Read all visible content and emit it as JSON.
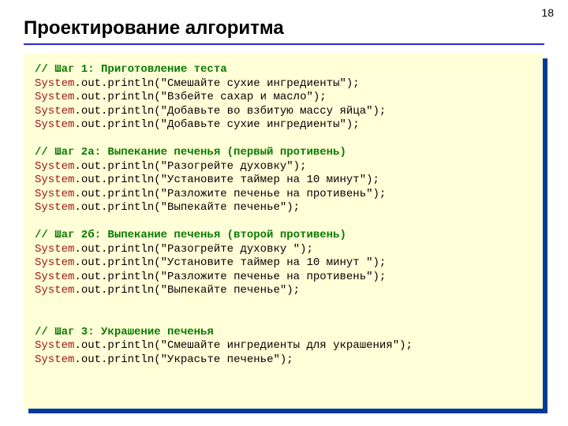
{
  "page_number": "18",
  "title": "Проектирование алгоритма",
  "code": {
    "sys": "System",
    "out_print": ".out.println",
    "c1": "// Шаг 1: Приготовление теста",
    "s1": "(\"Смешайте сухие ингредиенты\");",
    "s2": "(\"Взбейте сахар и масло\");",
    "s3": "(\"Добавьте во взбитую массу яйца\");",
    "s4": "(\"Добавьте сухие ингредиенты\");",
    "c2": "// Шаг 2а: Выпекание печенья (первый противень)",
    "s5": "(\"Разогрейте духовку\");",
    "s6": "(\"Установите таймер на 10 минут\");",
    "s7": "(\"Разложите печенье на противень\");",
    "s8": "(\"Выпекайте печенье\");",
    "c3": "// Шаг 2б: Выпекание печенья (второй противень)",
    "s9": "(\"Разогрейте духовку \");",
    "s10": "(\"Установите таймер на 10 минут \");",
    "s11": "(\"Разложите печенье на противень\");",
    "s12": "(\"Выпекайте печенье\");",
    "c4": "// Шаг 3: Украшение печенья",
    "s13": "(\"Смешайте ингредиенты для украшения\");",
    "s14": "(\"Украсьте печенье\");"
  }
}
